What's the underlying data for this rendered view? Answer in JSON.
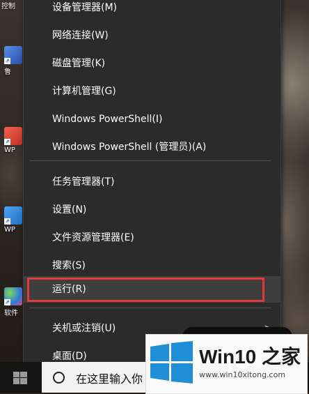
{
  "desktop": {
    "top_label": "控制",
    "icons": [
      {
        "label": "鲁",
        "color": "#3a6fd8"
      },
      {
        "label": "WP",
        "color": "#e04a3a"
      },
      {
        "label": "WP",
        "color": "#3a8fe0"
      },
      {
        "label": "软件",
        "color": "#2d7be0"
      }
    ]
  },
  "menu": {
    "items": [
      "设备管理器(M)",
      "网络连接(W)",
      "磁盘管理(K)",
      "计算机管理(G)",
      "Windows PowerShell(I)",
      "Windows PowerShell (管理员)(A)",
      "任务管理器(T)",
      "设置(N)",
      "文件资源管理器(E)",
      "搜索(S)",
      "运行(R)",
      "关机或注销(U)",
      "桌面(D)"
    ],
    "submenu_arrow": ">",
    "highlight_color": "#e23a3a"
  },
  "taskbar": {
    "search_placeholder": "在这里输入你"
  },
  "watermark": {
    "brand": "Win10 之家",
    "url": "www.win10xitong.com",
    "logo_color": "#1e8fd6"
  }
}
